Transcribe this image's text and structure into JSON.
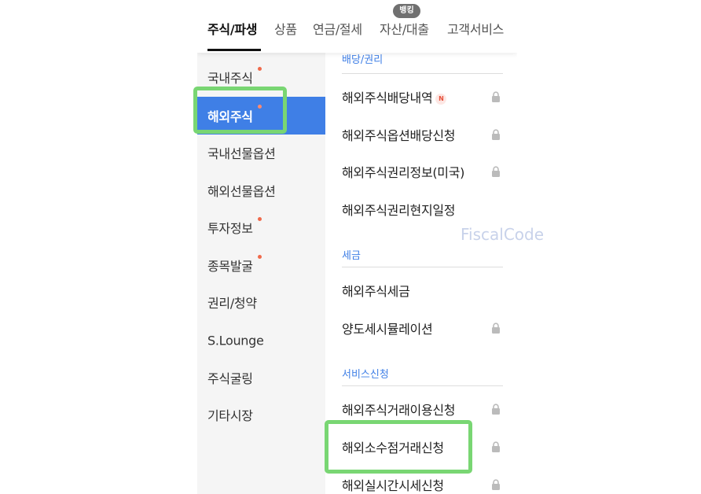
{
  "top_tabs": [
    {
      "label": "주식/파생",
      "active": true
    },
    {
      "label": "상품"
    },
    {
      "label": "연금/절세"
    },
    {
      "label": "자산/대출"
    },
    {
      "label": "고객서비스"
    }
  ],
  "top_badge": "뱅킹",
  "left_menu": [
    {
      "label": "국내주식",
      "dot": true
    },
    {
      "label": "해외주식",
      "dot": true,
      "active": true
    },
    {
      "label": "국내선물옵션"
    },
    {
      "label": "해외선물옵션"
    },
    {
      "label": "투자정보",
      "dot": true
    },
    {
      "label": "종목발굴",
      "dot": true
    },
    {
      "label": "권리/청약"
    },
    {
      "label": "S.Lounge"
    },
    {
      "label": "주식굴링"
    },
    {
      "label": "기타시장"
    }
  ],
  "sections": [
    {
      "title": "배당/권리",
      "items": [
        {
          "label": "해외주식배당내역",
          "new_badge": "N",
          "locked": true
        },
        {
          "label": "해외주식옵션배당신청",
          "locked": true
        },
        {
          "label": "해외주식권리정보(미국)",
          "locked": true
        },
        {
          "label": "해외주식권리현지일정",
          "locked": false
        }
      ]
    },
    {
      "title": "세금",
      "items": [
        {
          "label": "해외주식세금",
          "locked": false
        },
        {
          "label": "양도세시뮬레이션",
          "locked": true
        }
      ]
    },
    {
      "title": "서비스신청",
      "items": [
        {
          "label": "해외주식거래이용신청",
          "locked": true
        },
        {
          "label": "해외소수점거래신청",
          "locked": true
        },
        {
          "label": "해외실시간시세신청",
          "locked": true
        }
      ]
    }
  ],
  "watermark": "FiscalCode",
  "colors": {
    "accent_blue": "#3f7fe6",
    "highlight_green": "#79d673",
    "new_dot": "#f06a4b"
  }
}
